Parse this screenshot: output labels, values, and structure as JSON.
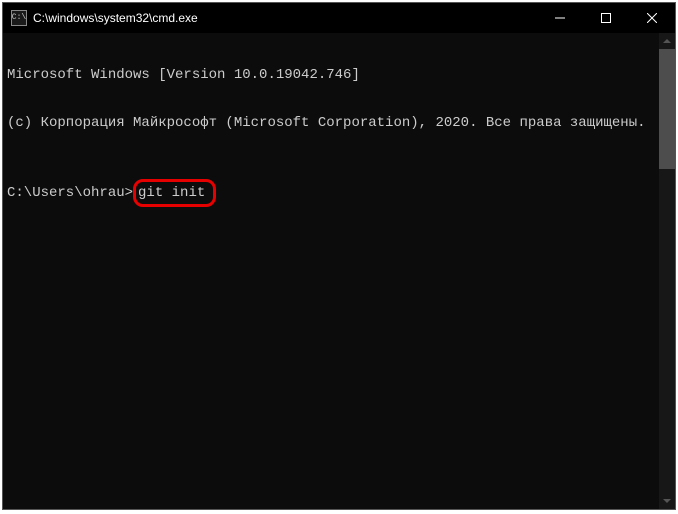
{
  "titlebar": {
    "icon_text": "C:\\",
    "title": "C:\\windows\\system32\\cmd.exe"
  },
  "console": {
    "line1": "Microsoft Windows [Version 10.0.19042.746]",
    "line2": "(c) Корпорация Майкрософт (Microsoft Corporation), 2020. Все права защищены.",
    "prompt": "C:\\Users\\ohrau>",
    "command": "git init"
  }
}
